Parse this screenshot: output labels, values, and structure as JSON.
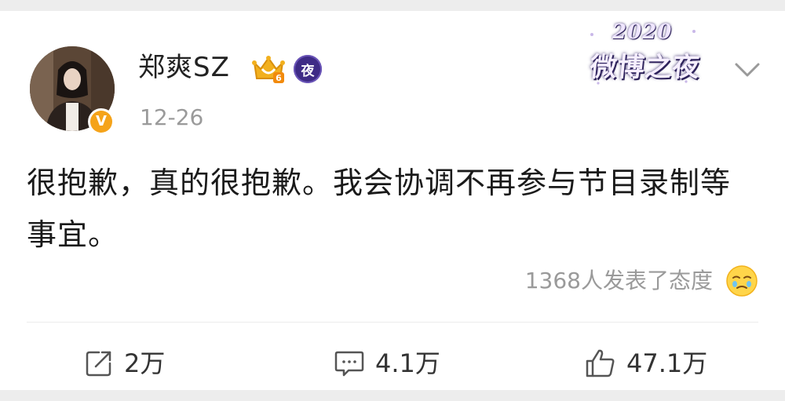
{
  "post": {
    "author": {
      "name": "郑爽SZ",
      "verified_mark": "V",
      "night_badge": "夜"
    },
    "date": "12-26",
    "event_badge": {
      "year": "2020",
      "name": "微博之夜"
    },
    "text": "很抱歉，真的很抱歉。我会协调不再参与节目录制等事宜。",
    "reactions_text": "1368人发表了态度",
    "actions": {
      "repost_count": "2万",
      "comment_count": "4.1万",
      "like_count": "47.1万"
    }
  },
  "icons": {
    "repost": "repost-icon",
    "comment": "comment-icon",
    "like": "thumbs-up-icon",
    "more": "chevron-down-icon",
    "vip": "crown-vip-icon",
    "emoji": "teary-face-icon"
  },
  "colors": {
    "background": "#ededed",
    "card": "#ffffff",
    "text": "#1a1a1a",
    "muted": "#9a9a9a",
    "verified_orange": "#f5a31a",
    "night_badge_purple": "#3e2b86",
    "vip_gold": "#f2b01e"
  }
}
